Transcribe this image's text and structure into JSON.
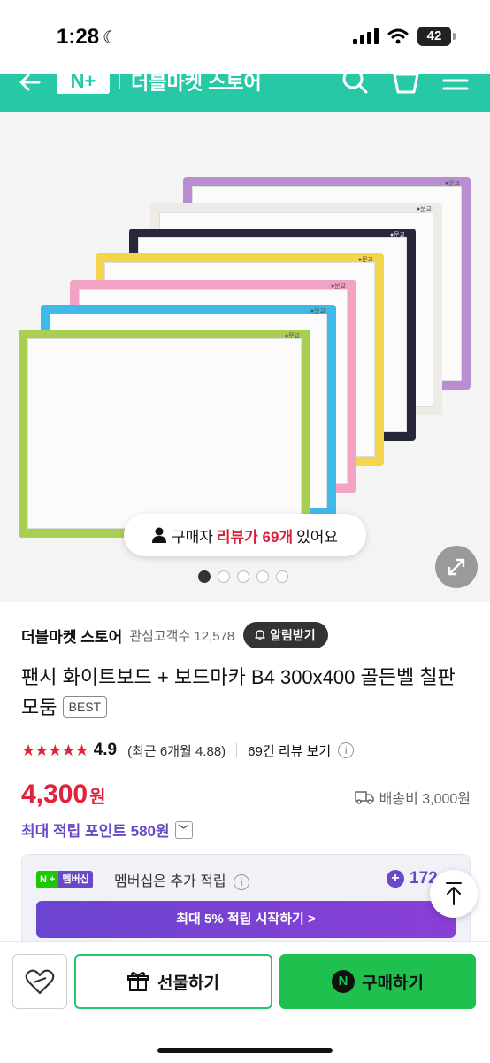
{
  "status_bar": {
    "time": "1:28",
    "battery": "42"
  },
  "header": {
    "logo": "N+",
    "store_title": "더블마켓 스토어"
  },
  "gallery": {
    "review_prefix": "구매자",
    "review_highlight": "리뷰가 69개",
    "review_suffix": "있어요",
    "board_colors": [
      "#b98ed0",
      "#eeeae6",
      "#262739",
      "#f3d64c",
      "#f2a3c4",
      "#3fb8ea",
      "#a9cf52"
    ],
    "current_slide": 1,
    "total_slides": 5
  },
  "store": {
    "name": "더블마켓 스토어",
    "fans": "관심고객수 12,578",
    "alarm_label": "알림받기"
  },
  "product": {
    "title": "팬시 화이트보드 + 보드마카 B4 300x400 골든벨 칠판 모둠",
    "badge": "BEST"
  },
  "rating": {
    "stars": "★★★★★",
    "value": "4.9",
    "recent": "(최근 6개월 4.88)",
    "review_link": "69건 리뷰 보기",
    "info": "i"
  },
  "price": {
    "amount": "4,300",
    "unit": "원",
    "shipping": "배송비 3,000원"
  },
  "points": {
    "label": "최대 적립 포인트 580원"
  },
  "membership": {
    "logo_n": "N +",
    "logo_m": "멤버십",
    "text": "멤버십은 추가 적립",
    "points": "172",
    "cta": "최대 5% 적립 시작하기 >"
  },
  "bottom": {
    "gift_label": "선물하기",
    "buy_label": "구매하기"
  }
}
